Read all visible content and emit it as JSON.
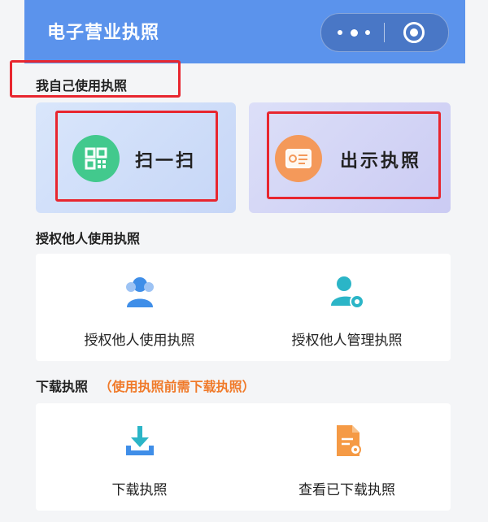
{
  "header": {
    "title": "电子营业执照"
  },
  "sections": {
    "self": {
      "label": "我自己使用执照"
    },
    "authorize": {
      "label": "授权他人使用执照"
    },
    "download": {
      "label": "下载执照",
      "note": "（使用执照前需下载执照）"
    }
  },
  "cards": {
    "scan": {
      "label": "扫一扫"
    },
    "show": {
      "label": "出示执照"
    }
  },
  "authorize_items": [
    {
      "label": "授权他人使用执照"
    },
    {
      "label": "授权他人管理执照"
    }
  ],
  "download_items": [
    {
      "label": "下载执照"
    },
    {
      "label": "查看已下载执照"
    }
  ],
  "colors": {
    "header": "#5b93ec",
    "highlight_box": "#e8262f",
    "note": "#f07a2a",
    "qr_icon": "#42c98d",
    "license_icon": "#f4995a",
    "icon_blue": "#3f8ee8",
    "icon_teal": "#2bb5c7",
    "icon_orange": "#f59a45"
  },
  "icons": [
    "more-icon",
    "close-icon",
    "qr-code-icon",
    "license-card-icon",
    "users-icon",
    "user-settings-icon",
    "download-icon",
    "document-view-icon"
  ]
}
